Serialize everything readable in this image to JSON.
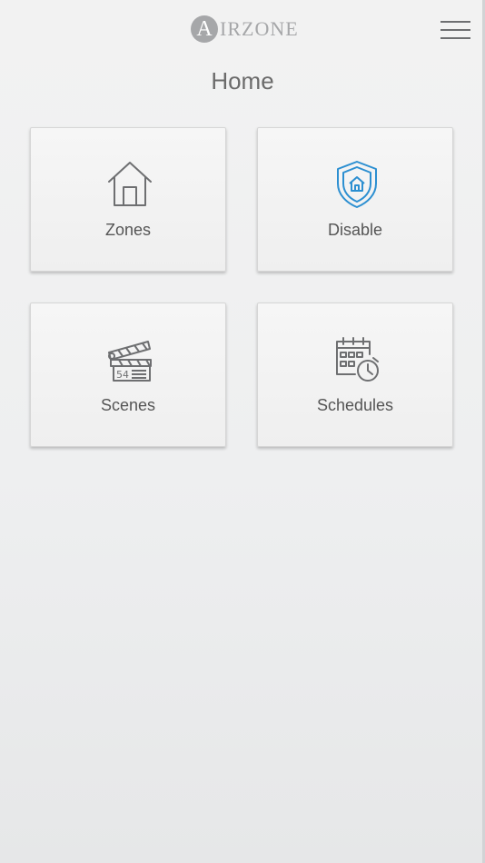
{
  "header": {
    "logo_initial": "A",
    "logo_text": "IRZONE",
    "menu_icon": "hamburger-menu-icon"
  },
  "page": {
    "title": "Home"
  },
  "tiles": [
    {
      "label": "Zones",
      "icon": "house-icon"
    },
    {
      "label": "Disable",
      "icon": "shield-home-icon"
    },
    {
      "label": "Scenes",
      "icon": "clapperboard-icon"
    },
    {
      "label": "Schedules",
      "icon": "calendar-clock-icon"
    }
  ],
  "colors": {
    "icon_gray": "#6e6f71",
    "accent_blue": "#2c8fd1",
    "label_text": "#555555",
    "title_text": "#6b6b6b"
  }
}
